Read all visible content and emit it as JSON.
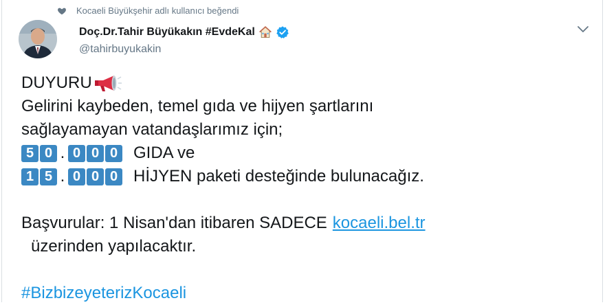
{
  "social_context": {
    "text": "Kocaeli Büyükşehir adlı kullanıcı beğendi",
    "icon": "heart-icon"
  },
  "author": {
    "display_name": "Doç.Dr.Tahir Büyükakın #EvdeKal",
    "handle": "@tahirbuyukakin",
    "icons": [
      "house-icon",
      "verified-icon"
    ]
  },
  "colors": {
    "link": "#1b95e0",
    "keycap": "#3b88c3",
    "muted": "#657786",
    "megaphone": "#dd2e44"
  },
  "tweet": {
    "line1": "DUYURU",
    "line2": "Gelirini kaybeden, temel gıda ve hijyen şartlarını",
    "line3": "sağlayamayan vatandaşlarımız için;",
    "number1": {
      "digits": [
        "5",
        "0",
        "0",
        "0",
        "0"
      ],
      "text": "GIDA ve"
    },
    "number2": {
      "digits": [
        "1",
        "5",
        "0",
        "0",
        "0"
      ],
      "text": "HİJYEN paketi desteğinde bulunacağız."
    },
    "line_apply_prefix": "Başvurular: 1 Nisan'dan itibaren SADECE",
    "link": "kocaeli.bel.tr",
    "line_apply_suffix": "üzerinden yapılacaktır.",
    "hashtag": "#BizbizeyeterizKocaeli"
  }
}
